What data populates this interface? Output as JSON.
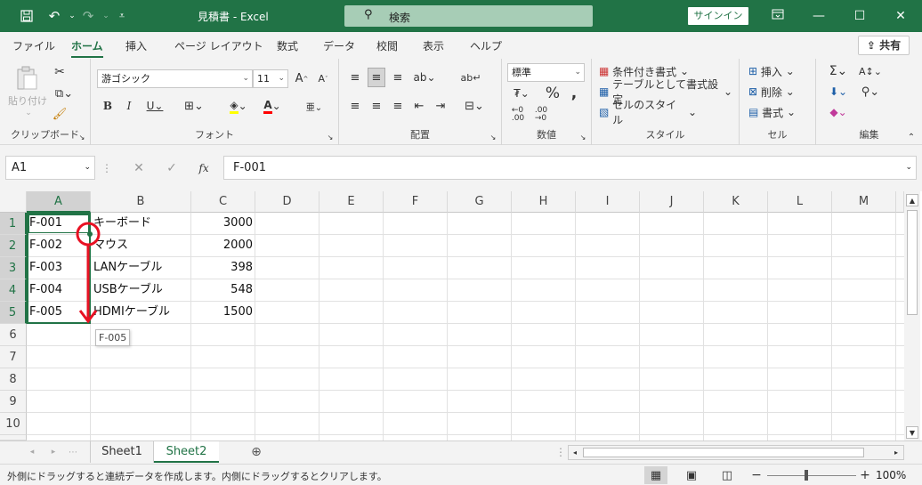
{
  "titlebar": {
    "title": "見積書  -  Excel",
    "search_placeholder": "検索",
    "signin": "サインイン"
  },
  "tabs": [
    "ファイル",
    "ホーム",
    "挿入",
    "ページ レイアウト",
    "数式",
    "データ",
    "校閲",
    "表示",
    "ヘルプ"
  ],
  "active_tab": "ホーム",
  "share_label": "共有",
  "ribbon": {
    "clipboard": {
      "paste": "貼り付け",
      "label": "クリップボード"
    },
    "font": {
      "font_name": "游ゴシック",
      "font_size": "11",
      "label": "フォント"
    },
    "alignment": {
      "label": "配置"
    },
    "number": {
      "format": "標準",
      "label": "数値"
    },
    "styles": {
      "conditional": "条件付き書式",
      "table": "テーブルとして書式設定",
      "cell_styles": "セルのスタイル",
      "label": "スタイル"
    },
    "cells": {
      "insert": "挿入",
      "delete": "削除",
      "format": "書式",
      "label": "セル"
    },
    "editing": {
      "label": "編集"
    }
  },
  "formula": {
    "name_box": "A1",
    "content": "F-001"
  },
  "grid": {
    "columns": [
      "A",
      "B",
      "C",
      "D",
      "E",
      "F",
      "G",
      "H",
      "I",
      "J",
      "K",
      "L",
      "M"
    ],
    "rows": [
      "1",
      "2",
      "3",
      "4",
      "5",
      "6",
      "7",
      "8",
      "9",
      "10"
    ],
    "data": [
      {
        "a": "F-001",
        "b": "キーボード",
        "c": "3000"
      },
      {
        "a": "F-002",
        "b": "マウス",
        "c": "2000"
      },
      {
        "a": "F-003",
        "b": "LANケーブル",
        "c": "398"
      },
      {
        "a": "F-004",
        "b": "USBケーブル",
        "c": "548"
      },
      {
        "a": "F-005",
        "b": "HDMIケーブル",
        "c": "1500"
      }
    ]
  },
  "drag_tooltip": "F-005",
  "sheets": [
    "Sheet1",
    "Sheet2"
  ],
  "active_sheet": "Sheet2",
  "status": {
    "message": "外側にドラッグすると連続データを作成します。内側にドラッグするとクリアします。",
    "zoom": "100%"
  },
  "colors": {
    "accent": "#217346",
    "drag_arrow": "#e81123"
  }
}
